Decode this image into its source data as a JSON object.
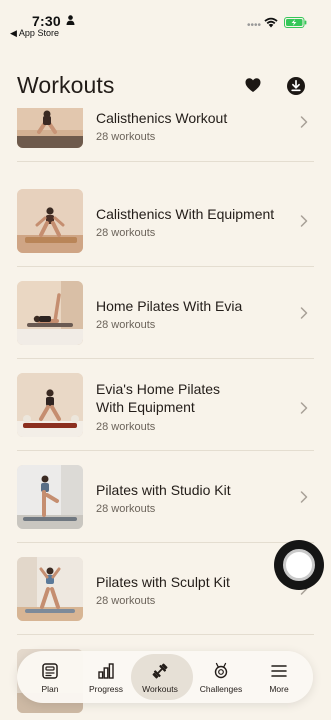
{
  "status_bar": {
    "time": "7:30",
    "back_app": "◀ App Store"
  },
  "header": {
    "title": "Workouts",
    "favorites_icon": "heart-icon",
    "download_icon": "download-icon"
  },
  "programs": [
    {
      "title": "Calisthenics Workout",
      "subtitle": "28 workouts"
    },
    {
      "title": "Calisthenics With Equipment",
      "subtitle": "28 workouts"
    },
    {
      "title": "Home Pilates With Evia",
      "subtitle": "28 workouts"
    },
    {
      "title": "Evia's Home Pilates With Equipment",
      "title_line1": "Evia's Home Pilates",
      "title_line2": "With Equipment",
      "subtitle": "28 workouts"
    },
    {
      "title": "Pilates with Studio Kit",
      "subtitle": "28 workouts"
    },
    {
      "title": "Pilates with Sculpt Kit",
      "subtitle": "28 workouts"
    }
  ],
  "tab_bar": {
    "tabs": [
      {
        "label": "Plan",
        "icon": "plan-icon"
      },
      {
        "label": "Progress",
        "icon": "bar-chart-icon"
      },
      {
        "label": "Workouts",
        "icon": "dumbbell-icon",
        "active": true
      },
      {
        "label": "Challenges",
        "icon": "trophy-icon"
      },
      {
        "label": "More",
        "icon": "menu-icon"
      }
    ]
  },
  "colors": {
    "background": "#f8f3ea",
    "text": "#231d19",
    "subtext": "#6c645b",
    "active_tab": "#e6e0d6",
    "battery": "#35c759"
  }
}
